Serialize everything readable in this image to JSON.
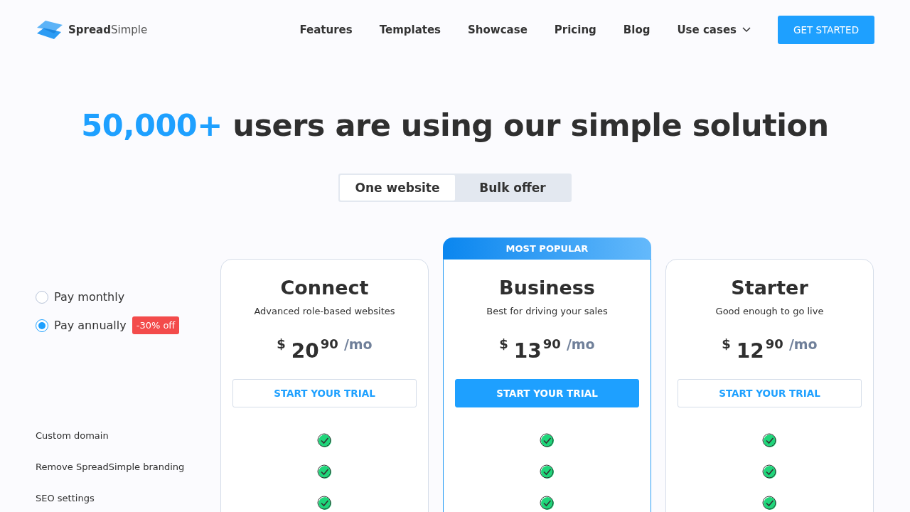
{
  "header": {
    "logo": {
      "bold": "Spread",
      "light": "Simple"
    },
    "nav": [
      {
        "label": "Features",
        "dropdown": false
      },
      {
        "label": "Templates",
        "dropdown": false
      },
      {
        "label": "Showcase",
        "dropdown": false
      },
      {
        "label": "Pricing",
        "dropdown": false
      },
      {
        "label": "Blog",
        "dropdown": false
      },
      {
        "label": "Use cases",
        "dropdown": true
      }
    ],
    "cta": "GET STARTED"
  },
  "headline": {
    "highlight": "50,000+",
    "rest": "users are using our simple solution"
  },
  "tabs": [
    {
      "label": "One website",
      "selected": true
    },
    {
      "label": "Bulk offer",
      "selected": false
    }
  ],
  "billing": [
    {
      "label": "Pay monthly",
      "selected": false
    },
    {
      "label": "Pay annually",
      "selected": true,
      "badge": "-30% off"
    }
  ],
  "features": [
    "Custom domain",
    "Remove SpreadSimple branding",
    "SEO settings"
  ],
  "plans": [
    {
      "name": "Connect",
      "subtitle": "Advanced role-based websites",
      "currency": "$",
      "price": "20",
      "cents": "90",
      "period": "/mo",
      "button": "START YOUR TRIAL",
      "featured": false,
      "included": [
        true,
        true,
        true
      ]
    },
    {
      "name": "Business",
      "subtitle": "Best for driving your sales",
      "currency": "$",
      "price": "13",
      "cents": "90",
      "period": "/mo",
      "button": "START YOUR TRIAL",
      "featured": true,
      "badge": "MOST POPULAR",
      "included": [
        true,
        true,
        true
      ]
    },
    {
      "name": "Starter",
      "subtitle": "Good enough to go live",
      "currency": "$",
      "price": "12",
      "cents": "90",
      "period": "/mo",
      "button": "START YOUR TRIAL",
      "featured": false,
      "included": [
        true,
        true,
        true
      ]
    }
  ]
}
